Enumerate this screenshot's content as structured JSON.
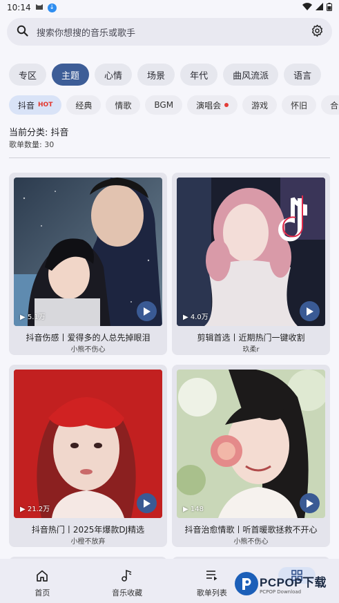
{
  "status": {
    "time": "10:14"
  },
  "search": {
    "placeholder": "搜索你想搜的音乐或歌手"
  },
  "categories": [
    {
      "label": "专区",
      "active": false
    },
    {
      "label": "主题",
      "active": true
    },
    {
      "label": "心情",
      "active": false
    },
    {
      "label": "场景",
      "active": false
    },
    {
      "label": "年代",
      "active": false
    },
    {
      "label": "曲风流派",
      "active": false
    },
    {
      "label": "语言",
      "active": false
    }
  ],
  "tags": {
    "t0": "抖音",
    "t0_badge": "HOT",
    "t1": "经典",
    "t2": "情歌",
    "t3": "BGM",
    "t4": "演唱会",
    "t5": "游戏",
    "t6": "怀旧",
    "t7": "合"
  },
  "info": {
    "current": "当前分类: 抖音",
    "count": "歌单数量: 30"
  },
  "cards": [
    {
      "title": "抖音伤感丨爱得多的人总先掉眼泪",
      "creator": "小熊不伤心",
      "plays": "5.1万"
    },
    {
      "title": "剪辑首选丨近期热门一键收割",
      "creator": "玖柔r",
      "plays": "4.0万"
    },
    {
      "title": "抖音热门丨2025年爆款DJ精选",
      "creator": "小橙不放弃",
      "plays": "21.2万"
    },
    {
      "title": "抖音治愈情歌丨听首暖歌拯救不开心",
      "creator": "小熊不伤心",
      "plays": "148"
    }
  ],
  "nav": [
    {
      "label": "首页",
      "icon": "home-icon"
    },
    {
      "label": "音乐收藏",
      "icon": "music-note-icon"
    },
    {
      "label": "歌单列表",
      "icon": "playlist-icon"
    },
    {
      "label": "",
      "icon": "grid-icon",
      "active": true
    }
  ],
  "watermark": {
    "main": "PCPOP下载",
    "sub": "PCPOP Download"
  },
  "colors": {
    "accent": "#3d5d97",
    "hot": "#e3352c",
    "background": "#f6f6fb"
  }
}
